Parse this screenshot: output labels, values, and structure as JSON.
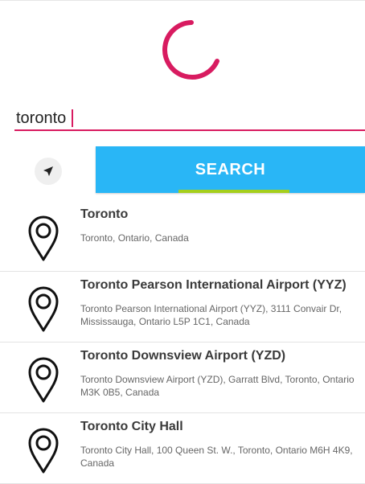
{
  "search": {
    "value": "toronto",
    "button_label": "SEARCH"
  },
  "icons": {
    "spinner": "loading-spinner-icon",
    "locate": "navigation-arrow-icon",
    "result": "map-pin-icon"
  },
  "colors": {
    "accent": "#d81b60",
    "button": "#29b6f6",
    "button_indicator": "#a5cf1c"
  },
  "results": [
    {
      "title": "Toronto",
      "address": "Toronto, Ontario, Canada"
    },
    {
      "title": "Toronto Pearson International Airport (YYZ)",
      "address": "Toronto Pearson International Airport (YYZ), 3111 Convair Dr, Mississauga, Ontario L5P 1C1, Canada"
    },
    {
      "title": "Toronto Downsview Airport (YZD)",
      "address": "Toronto Downsview Airport (YZD), Garratt Blvd, Toronto, Ontario M3K 0B5, Canada"
    },
    {
      "title": "Toronto City Hall",
      "address": "Toronto City Hall, 100 Queen St. W., Toronto, Ontario M6H 4K9, Canada"
    }
  ]
}
